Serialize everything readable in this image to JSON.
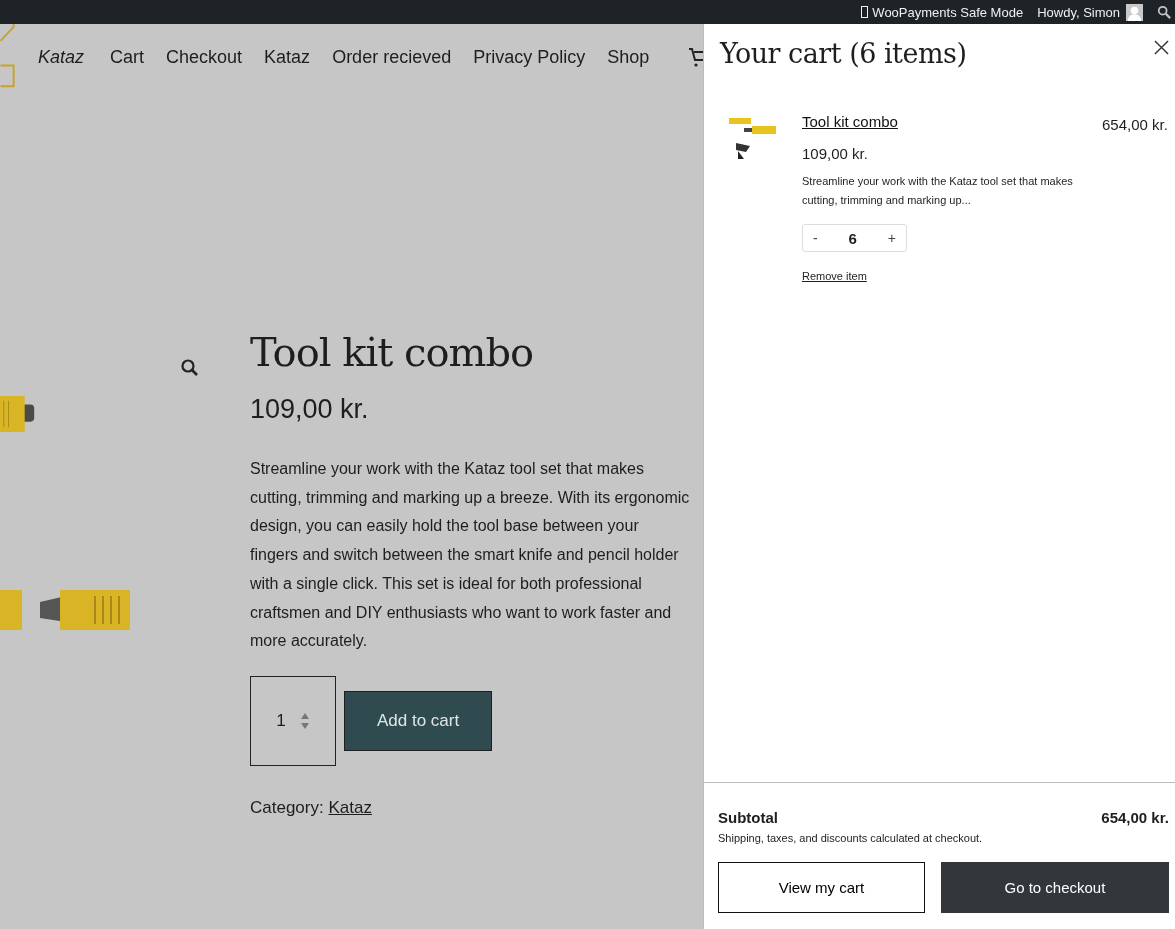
{
  "admin_bar": {
    "safe_mode": "WooPayments Safe Mode",
    "greeting": "Howdy, Simon"
  },
  "site": {
    "title": "Kataz"
  },
  "nav": {
    "items": [
      {
        "label": "Cart"
      },
      {
        "label": "Checkout"
      },
      {
        "label": "Kataz"
      },
      {
        "label": "Order recieved"
      },
      {
        "label": "Privacy Policy"
      },
      {
        "label": "Shop"
      }
    ]
  },
  "product": {
    "title": "Tool kit combo",
    "price": "109,00 kr.",
    "description": "Streamline your work with the Kataz tool set that makes cutting, trimming and marking up a breeze. With its ergonomic design, you can easily hold the tool base between your fingers and switch between the smart knife and pencil holder with a single click. This set is ideal for both professional craftsmen and DIY enthusiasts who want to work faster and more accurately.",
    "quantity": "1",
    "add_button": "Add to cart",
    "category_label": "Category:",
    "category": "Kataz"
  },
  "cart": {
    "title": "Your cart (6 items)",
    "items": [
      {
        "name": "Tool kit combo",
        "unit_price": "109,00 kr.",
        "total": "654,00 kr.",
        "summary": "Streamline your work with the Kataz tool set that makes cutting, trimming and marking up...",
        "minus": "-",
        "quantity": "6",
        "plus": "+",
        "remove": "Remove item"
      }
    ],
    "subtotal_label": "Subtotal",
    "subtotal": "654,00 kr.",
    "note": "Shipping, taxes, and discounts calculated at checkout.",
    "view_button": "View my cart",
    "checkout_button": "Go to checkout"
  }
}
